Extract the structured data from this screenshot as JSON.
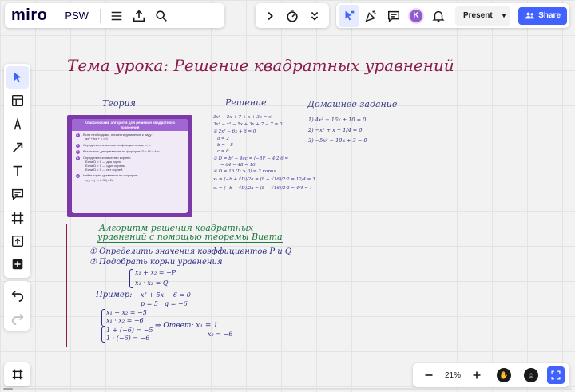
{
  "app": {
    "logo": "miro",
    "board_name": "PSW"
  },
  "toolbar_top": {
    "present_label": "Present",
    "share_label": "Share",
    "avatar_initial": "K"
  },
  "zoom": {
    "level": "21%"
  },
  "canvas": {
    "title": "Тема урока: Решение квадратных уравнений",
    "columns": {
      "theory": "Теория",
      "solution": "Решение",
      "homework": "Домашнее задание"
    },
    "card": {
      "header": "Классический алгоритм для решения квадратного уравнения",
      "steps": [
        {
          "n": "1",
          "text": "Если необходимо, привести уравнение к виду:",
          "extra": "ax² + bx + c = 0"
        },
        {
          "n": "2",
          "text": "Определить значения коэффициентов a, b, c.",
          "extra": ""
        },
        {
          "n": "3",
          "text": "Вычислить дискриминант по формуле: D = b² − 4ac",
          "extra": ""
        },
        {
          "n": "4",
          "text": "Определить количество корней:",
          "extra": ""
        },
        {
          "n": "5",
          "text": "Найти корни уравнения по формуле:",
          "extra": "x₁,₂ = (−b ± √D) / 2a"
        }
      ],
      "cases": [
        "Если D > 0 — два корня",
        "Если D = 0 — один корень",
        "Если D < 0 — нет корней"
      ]
    },
    "solution_lines": [
      "3x² − 5x + 7 + x + 3x = x²",
      "3x² − x² − 5x + 3x + 7 − 7 = 0",
      "① 2x² − 6x + 6 = 0",
      "a = 2",
      "b = −8",
      "c = 6",
      "③ D = b² − 4ac = (−8)² − 4·2·6 =",
      "= 64 − 48 = 16",
      "④ D = 16   (D > 0) ⇒ 2 корня",
      "x₁ = (−b + √D)/2a = (8 + √16)/2·2 = 12/4 = 3",
      "x₂ = (−b − √D)/2a = (8 − √16)/2·2 = 4/4 = 1"
    ],
    "homework_lines": [
      "1) 4x² − 16x + 10 = 0",
      "2) −x² + x + 1/4 = 0",
      "3) −5x² − 10x + 3 = 0"
    ],
    "algo_title_1": "Алгоритм решения квадратных",
    "algo_title_2": "уравнений с помощью теоремы Виета",
    "algo_items": [
      "① Определить значения коэффициентов P и Q",
      "② Подобрать корни уравнения"
    ],
    "vieta_sum": "x₁ + x₂ = −P",
    "vieta_prod": "x₁ · x₂ = Q",
    "example_label": "Пример:",
    "example_eq": "x² + 5x − 6 = 0",
    "example_p": "p = 5",
    "example_q": "q = −6",
    "ex_lines": [
      "x₁ + x₂ = −5",
      "x₁ · x₂ = −6",
      "1 + (−6) = −5",
      "1 · (−6) = −6"
    ],
    "answer": "⇒   Ответ: x₁ = 1",
    "answer_2": "x₂ = −6"
  }
}
